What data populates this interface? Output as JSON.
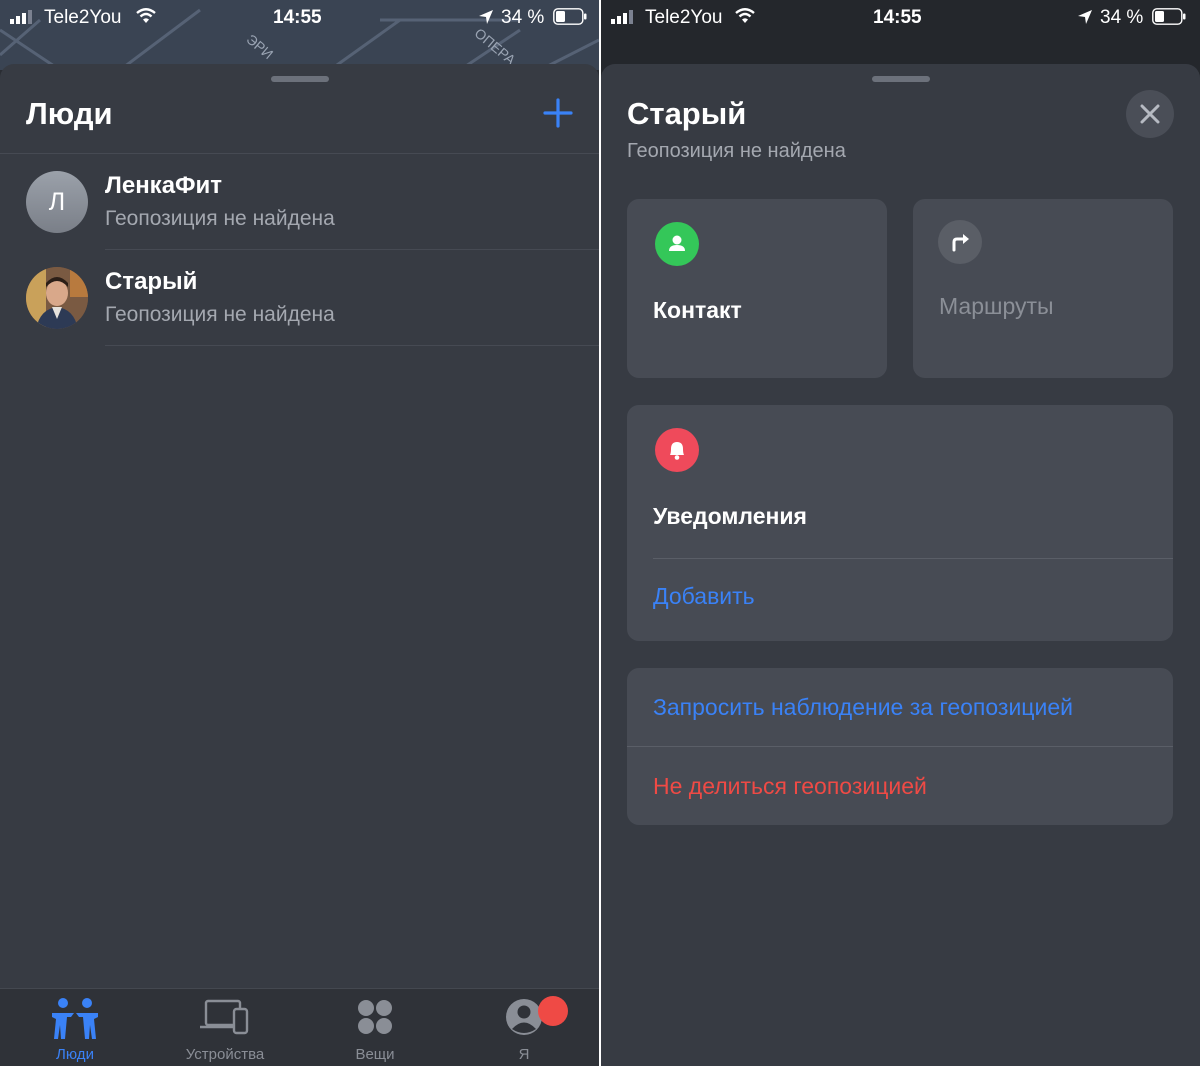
{
  "status_bar": {
    "carrier": "Tele2You",
    "time": "14:55",
    "battery": "34 %"
  },
  "map_labels": [
    "ЭРИ",
    "ОПЕРА"
  ],
  "people_panel": {
    "title": "Люди",
    "people": [
      {
        "initial": "Л",
        "name": "ЛенкаФит",
        "status": "Геопозиция не найдена"
      },
      {
        "name": "Старый",
        "status": "Геопозиция не найдена"
      }
    ]
  },
  "tab_bar": {
    "tabs": [
      {
        "label": "Люди",
        "icon": "people-icon",
        "active": true
      },
      {
        "label": "Устройства",
        "icon": "devices-icon"
      },
      {
        "label": "Вещи",
        "icon": "items-icon"
      },
      {
        "label": "Я",
        "icon": "me-icon",
        "has_badge": true
      }
    ]
  },
  "detail_panel": {
    "name": "Старый",
    "status": "Геопозиция не найдена",
    "contact_label": "Контакт",
    "directions_label": "Маршруты",
    "notifications_label": "Уведомления",
    "add_label": "Добавить",
    "request_label": "Запросить наблюдение за геопозицией",
    "stop_sharing_label": "Не делиться геопозицией"
  },
  "colors": {
    "accent": "#3a82f7",
    "destructive": "#ef4a45",
    "contact_green": "#34c759",
    "notification_red": "#ef4a5b"
  }
}
